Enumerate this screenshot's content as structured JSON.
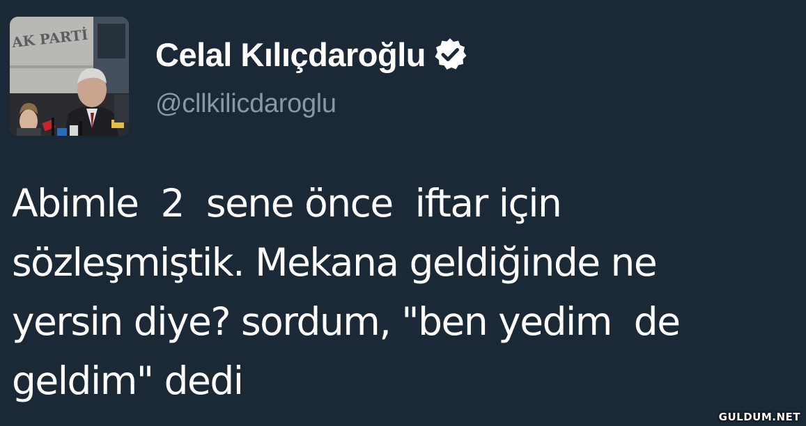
{
  "profile": {
    "display_name": "Celal Kılıçdaroğlu",
    "handle": "@cllkilicdaroglu",
    "verified_icon": "verified-badge-icon",
    "avatar_sign_text": "AK PARTİ"
  },
  "tweet": {
    "lines": [
      "Abimle  2  sene önce  iftar için",
      "sözleşmiştik. Mekana geldiğinde ne",
      "yersin diye? sordum, \"ben yedim  de",
      "geldim\" dedi"
    ]
  },
  "watermark": {
    "text": "GULDUM.NET"
  },
  "colors": {
    "background": "#1b2836",
    "name": "#ffffff",
    "handle": "#8899a6",
    "text": "#ffffff"
  }
}
